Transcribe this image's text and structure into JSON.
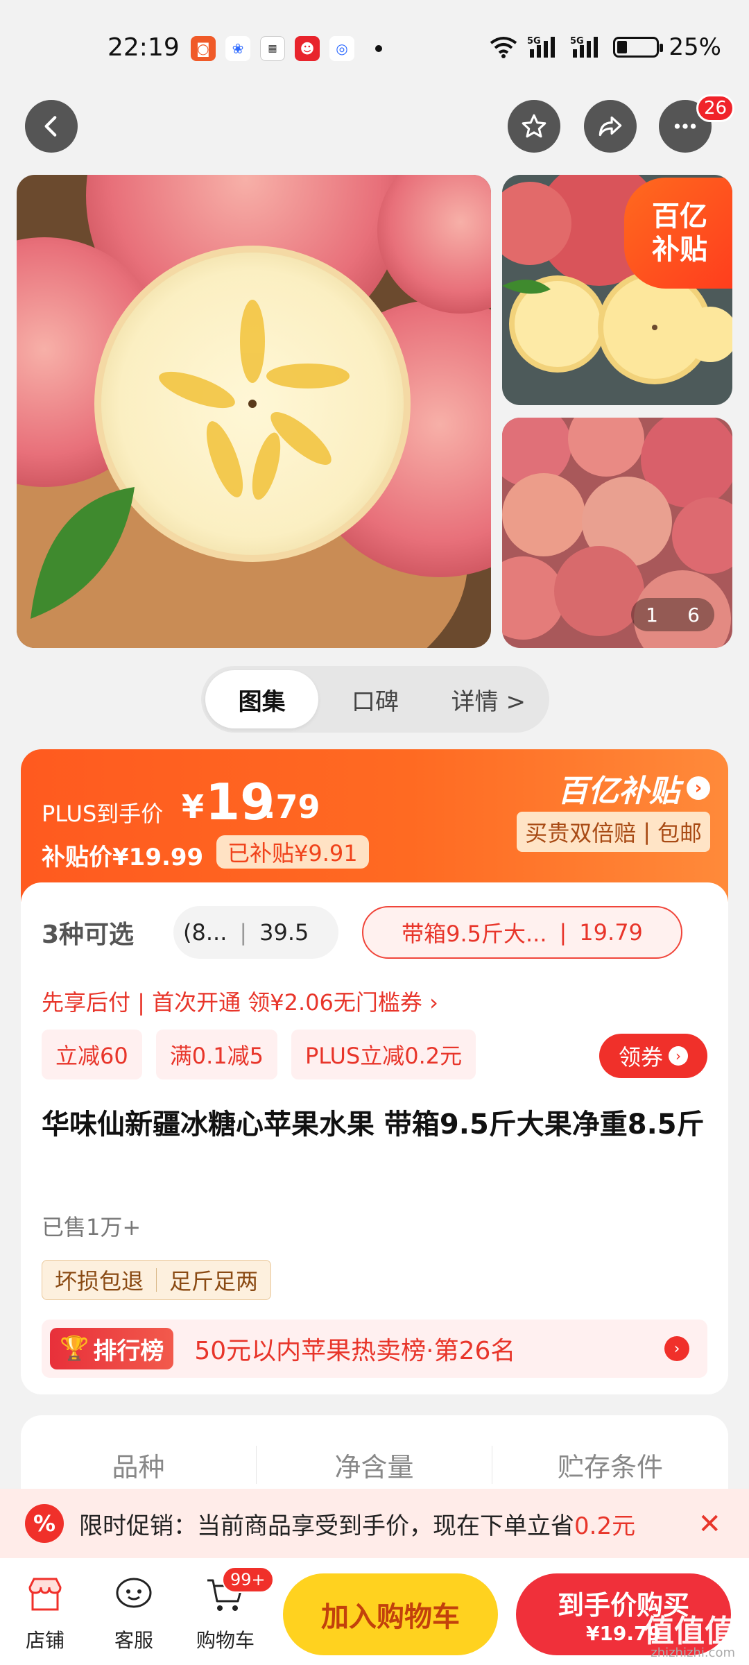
{
  "status_bar": {
    "time": "22:19",
    "battery": "25%",
    "signal_labels": [
      "5G",
      "5G"
    ]
  },
  "top_nav": {
    "more_badge": "26"
  },
  "gallery": {
    "subsidy_tag": [
      "百亿",
      "补贴"
    ],
    "page_current": "1",
    "page_total": "6"
  },
  "tabs": [
    {
      "label": "图集",
      "active": true
    },
    {
      "label": "口碑",
      "active": false
    },
    {
      "label": "详情 >",
      "active": false
    }
  ],
  "price": {
    "plus_label": "PLUS到手价",
    "currency": "¥",
    "integer": "19",
    "decimal": ".79",
    "subsidy_price": "补贴价¥19.99",
    "subsidized": "已补贴¥9.91",
    "brand": "百亿补贴",
    "guarantee": [
      "买贵双倍赔",
      "包邮"
    ]
  },
  "options": {
    "count": "3种可选",
    "option_a_name": "(8...",
    "option_a_price": "39.5",
    "option_b_name": "带箱9.5斤大...",
    "option_b_price": "19.79"
  },
  "promo_line": "先享后付 | 首次开通 领¥2.06无门槛券 ›",
  "chips": [
    "立减60",
    "满0.1减5",
    "PLUS立减0.2元"
  ],
  "coupon_button": "领券",
  "product_title": "华味仙新疆冰糖心苹果水果 带箱9.5斤大果净重8.5斤",
  "sold": "已售1万+",
  "service_tags": [
    "坏损包退",
    "足斤足两"
  ],
  "ranking": {
    "badge": "排行榜",
    "text": "50元以内苹果热卖榜·第26名"
  },
  "specs": [
    "品种",
    "净含量",
    "贮存条件"
  ],
  "notice": {
    "prefix": "限时促销：当前商品享受到手价，现在下单立省",
    "amount": "0.2元",
    "icon": "%"
  },
  "bottom_bar": {
    "store": "店铺",
    "service": "客服",
    "cart": "购物车",
    "cart_badge": "99+",
    "add_to_cart": "加入购物车",
    "buy_line1": "到手价购买",
    "buy_line2": "¥19.79"
  },
  "watermark": {
    "main": "值值值",
    "sub": "zhizhizhi.com"
  },
  "colors": {
    "accent_red": "#f0302a",
    "orange": "#ff5a1f",
    "yellow": "#ffd21f"
  }
}
